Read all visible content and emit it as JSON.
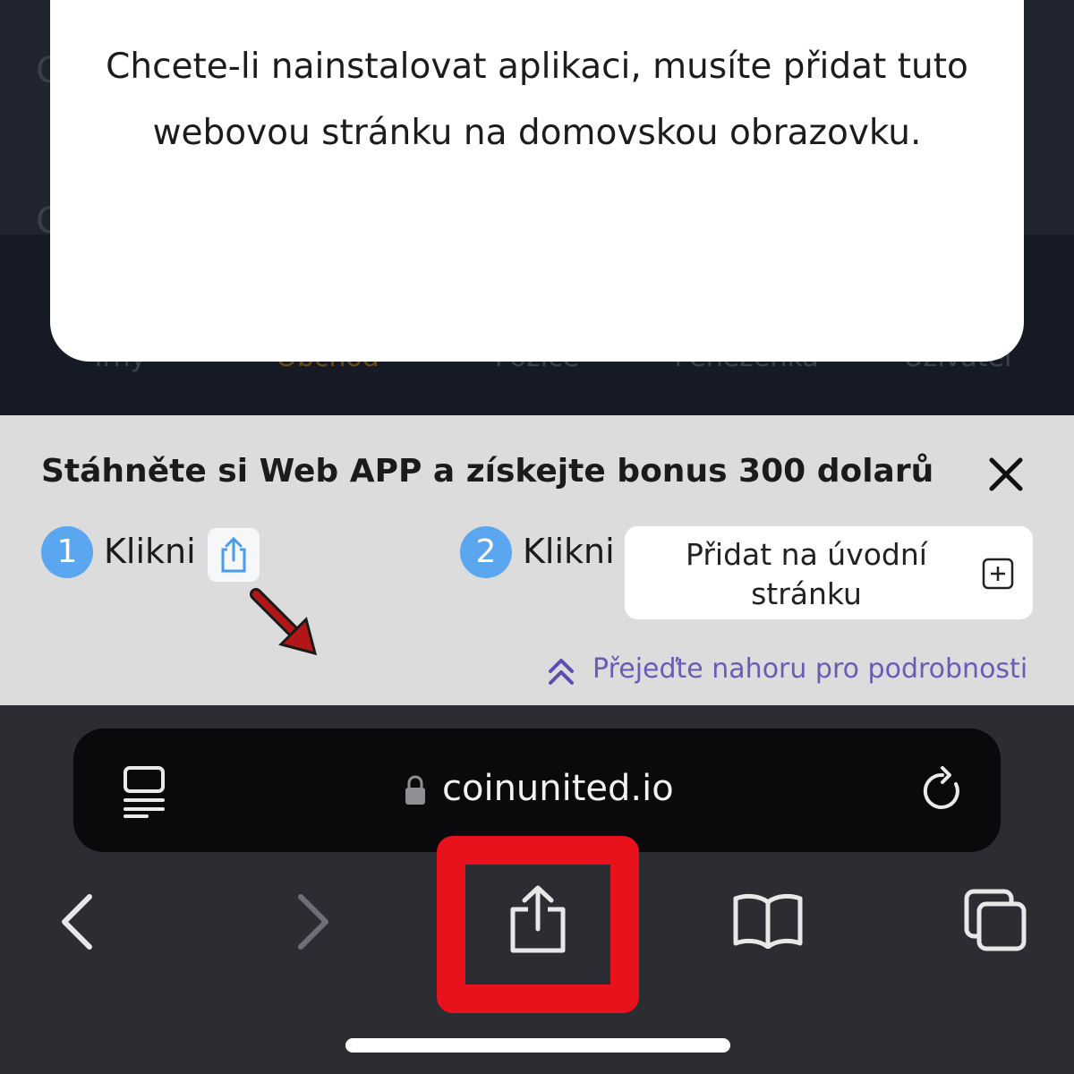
{
  "modal": {
    "message": "Chcete-li nainstalovat aplikaci, musíte přidat tuto webovou stránku na domovskou obrazovku."
  },
  "background_nav": {
    "items": [
      {
        "label": "Trhy",
        "active": false
      },
      {
        "label": "Obchod",
        "active": true
      },
      {
        "label": "Pozice",
        "active": false
      },
      {
        "label": "Peněženka",
        "active": false
      },
      {
        "label": "Uživatel",
        "active": false
      }
    ]
  },
  "banner": {
    "title": "Stáhněte si Web APP a získejte bonus 300 dolarů",
    "step1": {
      "number": "1",
      "label": "Klikni",
      "icon": "share-icon"
    },
    "step2": {
      "number": "2",
      "label": "Klikni",
      "button_label": "Přidat na úvodní stránku",
      "icon": "plus-square-icon"
    },
    "swipe_hint": "Přejeďte nahoru pro podrobnosti",
    "close_icon": "close-icon"
  },
  "browser": {
    "url": "coinunited.io",
    "toolbar": [
      "back-icon",
      "forward-icon",
      "share-icon",
      "bookmarks-icon",
      "tabs-icon"
    ]
  },
  "colors": {
    "accent_blue": "#5aa7ef",
    "highlight_red": "#e8121d",
    "hint_purple": "#6a5cb5"
  }
}
